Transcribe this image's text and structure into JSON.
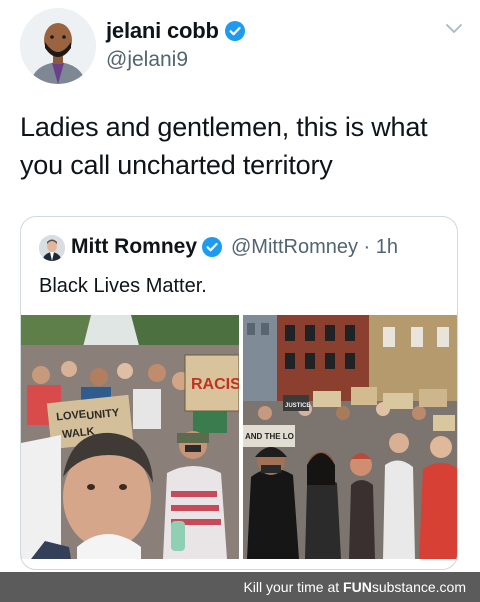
{
  "tweet": {
    "author_name": "jelani cobb",
    "author_handle": "@jelani9",
    "text": "Ladies and gentlemen, this is what you call uncharted territory",
    "quoted": {
      "author_name": "Mitt Romney",
      "author_handle": "@MittRomney · 1h",
      "text": "Black Lives Matter.",
      "photos": [
        "photo-crowd-selfie",
        "photo-protest-march"
      ]
    }
  },
  "sign_text": {
    "racism": "RACIS",
    "love": "LOVE",
    "unity": "UNITY",
    "walk": "WALK",
    "and_the_lord": "AND THE LO",
    "justice": "JUSTICE"
  },
  "footer": {
    "prefix": "Kill your time at ",
    "brand_bold": "FUN",
    "brand_rest": "substance",
    "domain": ".com"
  },
  "colors": {
    "verified": "#1d9bf0",
    "footer_bg": "#5b5b5b",
    "secondary_text": "#536471"
  }
}
